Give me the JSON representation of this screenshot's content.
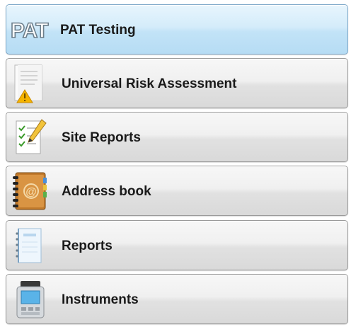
{
  "nav": {
    "items": [
      {
        "label": "PAT Testing",
        "icon": "pat-logo-icon",
        "icon_text": "PAT",
        "active": true
      },
      {
        "label": "Universal Risk Assessment",
        "icon": "risk-assessment-icon",
        "active": false
      },
      {
        "label": "Site Reports",
        "icon": "site-reports-icon",
        "active": false
      },
      {
        "label": "Address book",
        "icon": "address-book-icon",
        "active": false
      },
      {
        "label": "Reports",
        "icon": "reports-notebook-icon",
        "active": false
      },
      {
        "label": "Instruments",
        "icon": "instrument-icon",
        "active": false
      }
    ]
  },
  "colors": {
    "active_top": "#e8f5fd",
    "active_bottom": "#b6dcf4",
    "item_top": "#f7f7f7",
    "item_bottom": "#d9d9d9",
    "label": "#1a1a1a"
  }
}
